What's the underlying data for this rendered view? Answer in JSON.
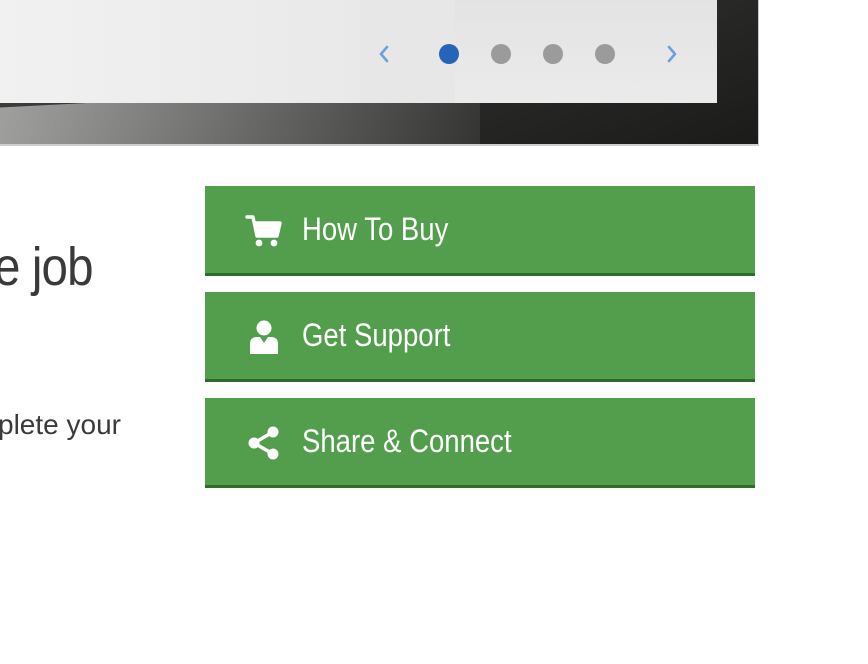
{
  "carousel": {
    "prev_icon": "chevron-left-icon",
    "next_icon": "chevron-right-icon",
    "slide_count": 4,
    "active_index": 0,
    "colors": {
      "active_dot": "#2564b8",
      "inactive_dot": "#9b9b9b",
      "arrow": "#6f9fd8"
    }
  },
  "content": {
    "heading_fragment": "e job",
    "body_fragment": "plete your"
  },
  "actions": {
    "color": "#529e4d",
    "items": [
      {
        "label": "How To Buy",
        "icon": "shopping-cart-icon"
      },
      {
        "label": "Get Support",
        "icon": "person-icon"
      },
      {
        "label": "Share & Connect",
        "icon": "share-icon"
      }
    ]
  }
}
